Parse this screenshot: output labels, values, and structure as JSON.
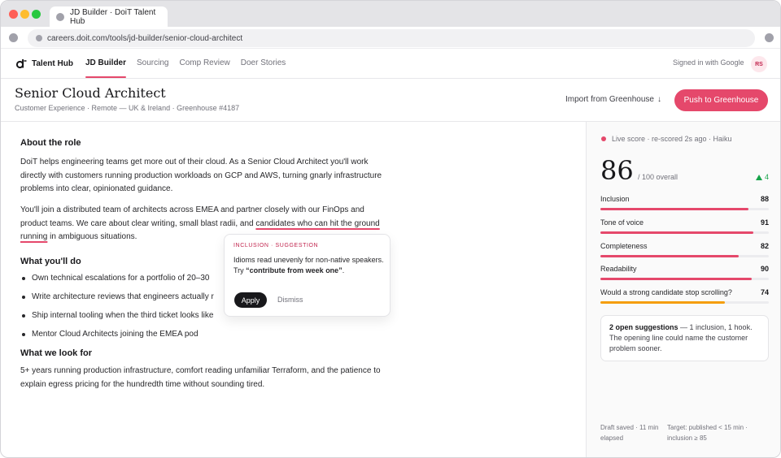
{
  "browser": {
    "tab_title": "JD Builder · DoiT Talent Hub",
    "url": "careers.doit.com/tools/jd-builder/senior-cloud-architect"
  },
  "appnav": {
    "brand": "Talent Hub",
    "links": [
      "JD Builder",
      "Sourcing",
      "Comp Review",
      "Doer Stories"
    ],
    "active": "JD Builder",
    "signed_in": "Signed in with Google",
    "avatar_initials": "RS"
  },
  "header": {
    "title": "Senior Cloud Architect",
    "subtitle": "Customer Experience · Remote — UK & Ireland · Greenhouse #4187",
    "import_label": "Import from Greenhouse",
    "import_icon": "arrow-down-icon",
    "push_label": "Push to Greenhouse"
  },
  "editor": {
    "about_heading": "About the role",
    "about_p1": "DoiT helps engineering teams get more out of their cloud. As a Senior Cloud Architect you'll work directly with customers running production workloads on GCP and AWS, turning gnarly infrastructure problems into clear, opinionated guidance.",
    "about_p2_before": "You'll join a distributed team of architects across EMEA and partner closely with our FinOps and product teams. We care about clear writing, small blast radii, and ",
    "about_p2_flagged": "candidates who can hit the ground running",
    "about_p2_after": " in ambiguous situations.",
    "do_heading": "What you'll do",
    "do_items": [
      "Own technical escalations for a portfolio of 20–30",
      "Write architecture reviews that engineers actually r",
      "Ship internal tooling when the third ticket looks like",
      "Mentor Cloud Architects joining the EMEA pod"
    ],
    "look_heading": "What we look for",
    "look_p": "5+ years running production infrastructure, comfort reading unfamiliar Terraform, and the patience to explain egress pricing for the hundredth time without sounding tired."
  },
  "suggestion": {
    "tag": "INCLUSION · SUGGESTION",
    "text_before": "Idioms read unevenly for non-native speakers. Try ",
    "text_bold": "“contribute from week one”",
    "text_after": ".",
    "apply": "Apply",
    "dismiss": "Dismiss"
  },
  "score": {
    "live_text": "Live score · re-scored 2s ago · Haiku",
    "overall": "86",
    "overall_suffix": "/ 100 overall",
    "delta": "4",
    "metrics": [
      {
        "label": "Inclusion",
        "value": "88",
        "color": "#e5486b"
      },
      {
        "label": "Tone of voice",
        "value": "91",
        "color": "#e5486b"
      },
      {
        "label": "Completeness",
        "value": "82",
        "color": "#e5486b"
      },
      {
        "label": "Readability",
        "value": "90",
        "color": "#e5486b"
      },
      {
        "label": "Would a strong candidate stop scrolling?",
        "value": "74",
        "color": "#f59e0b"
      }
    ],
    "note_bold": "2 open suggestions",
    "note_rest": " — 1 inclusion, 1 hook. The opening line could name the customer problem sooner.",
    "draft": "Draft saved · 11 min elapsed",
    "target": "Target: published < 15 min · inclusion ≥ 85"
  },
  "colors": {
    "accent": "#e5486b",
    "positive": "#16a34a",
    "warning": "#f59e0b"
  }
}
